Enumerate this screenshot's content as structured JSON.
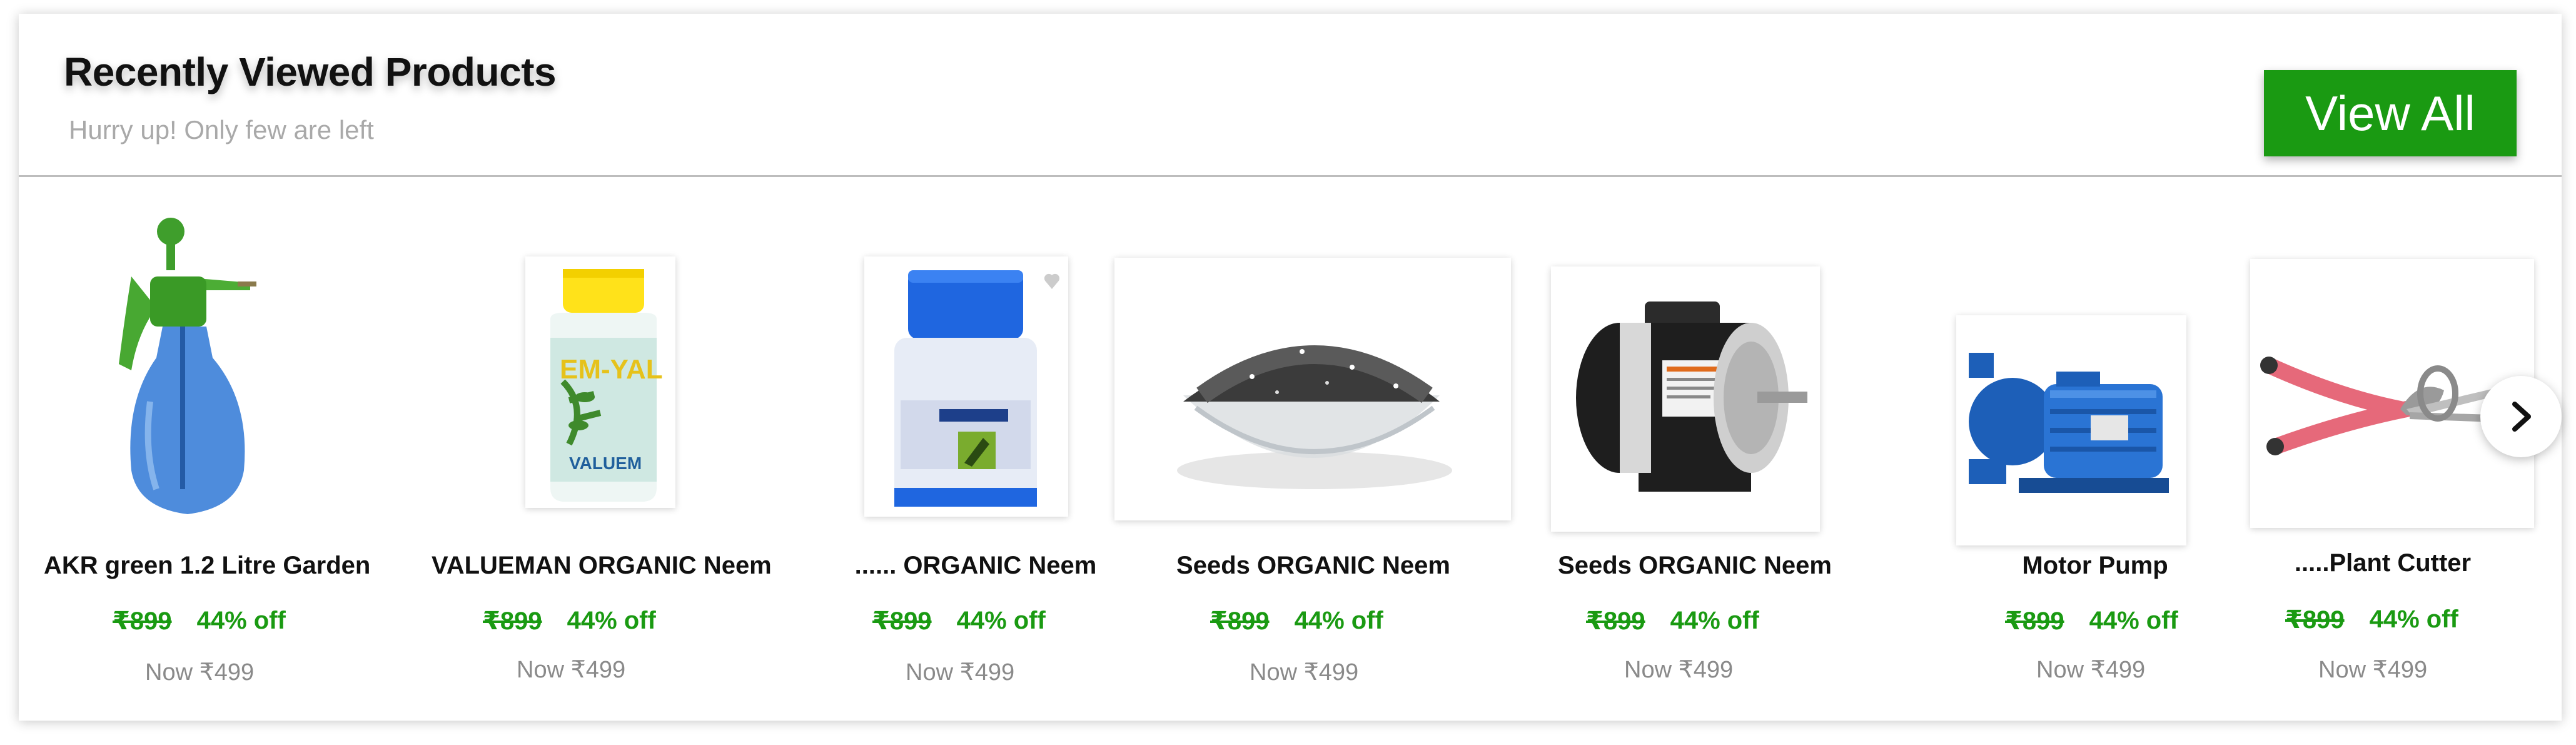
{
  "header": {
    "title": "Recently Viewed Products",
    "subtitle": "Hurry up! Only few are left",
    "view_all_label": "View All"
  },
  "colors": {
    "accent_green": "#1a9a12",
    "muted_text": "#8a8a8a"
  },
  "products": [
    {
      "name": "AKR green 1.2 Litre Garden",
      "old_price": "₹899",
      "discount": "44% off",
      "now_price": "Now ₹499",
      "image": "sprayer-bottle"
    },
    {
      "name": "VALUEMAN ORGANIC Neem",
      "old_price": "₹899",
      "discount": "44% off",
      "now_price": "Now ₹499",
      "image": "neem-oil-bottle"
    },
    {
      "name": "...... ORGANIC Neem",
      "old_price": "₹899",
      "discount": "44% off",
      "now_price": "Now ₹499",
      "image": "blue-cap-bottle"
    },
    {
      "name": "Seeds ORGANIC Neem",
      "old_price": "₹899",
      "discount": "44% off",
      "now_price": "Now ₹499",
      "image": "seeds-bowl"
    },
    {
      "name": "Seeds ORGANIC Neem",
      "old_price": "₹899",
      "discount": "44% off",
      "now_price": "Now ₹499",
      "image": "electric-motor"
    },
    {
      "name": "Motor Pump",
      "old_price": "₹899",
      "discount": "44% off",
      "now_price": "Now ₹499",
      "image": "water-pump"
    },
    {
      "name": ".....Plant Cutter",
      "old_price": "₹899",
      "discount": "44% off",
      "now_price": "Now ₹499",
      "image": "pruning-shears"
    }
  ],
  "carousel": {
    "next_icon": "chevron-right-icon"
  }
}
